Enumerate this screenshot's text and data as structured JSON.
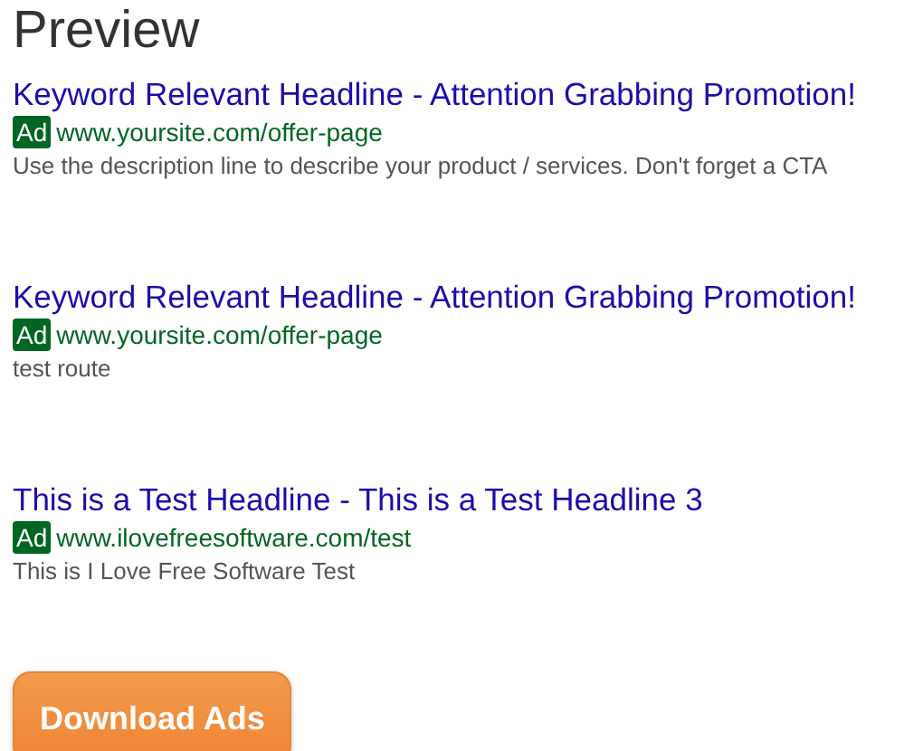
{
  "title": "Preview",
  "ads": [
    {
      "headline": "Keyword Relevant Headline - Attention Grabbing Promotion!",
      "badge": "Ad",
      "url": "www.yoursite.com/offer-page",
      "description": "Use the description line to describe your product / services. Don't forget a CTA"
    },
    {
      "headline": "Keyword Relevant Headline - Attention Grabbing Promotion!",
      "badge": "Ad",
      "url": "www.yoursite.com/offer-page",
      "description": "test route"
    },
    {
      "headline": "This is a Test Headline - This is a Test Headline 3",
      "badge": "Ad",
      "url": "www.ilovefreesoftware.com/test",
      "description": "This is I Love Free Software Test"
    }
  ],
  "button": "Download Ads"
}
